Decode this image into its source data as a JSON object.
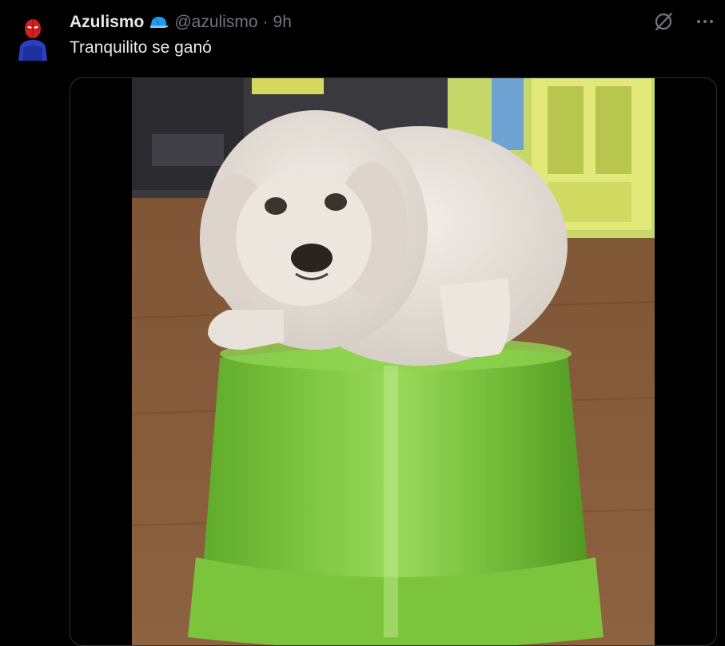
{
  "tweet": {
    "author_name": "Azulismo",
    "handle": "@azulismo",
    "separator": "·",
    "time": "9h",
    "text": "Tranquilito se ganó"
  },
  "icons": {
    "avatar": "spider-man-avatar",
    "badge": "blue-cap-icon",
    "grok": "grok-slash-icon",
    "more": "more-icon"
  },
  "colors": {
    "background": "#000000",
    "text_primary": "#e7e9ea",
    "text_secondary": "#71767b",
    "border": "#2f3336",
    "cap_blue": "#1d9bf0"
  }
}
